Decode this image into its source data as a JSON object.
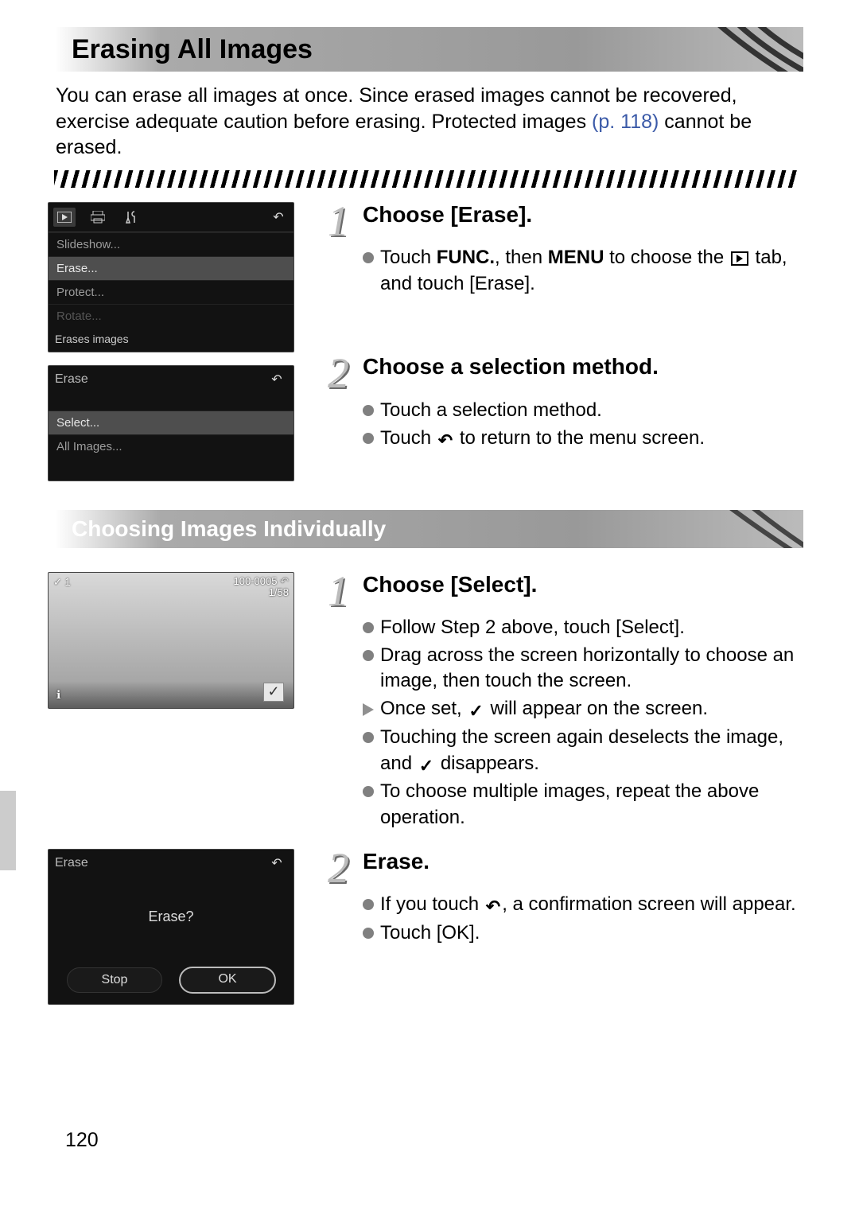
{
  "section1_title": "Erasing All Images",
  "intro_pre": "You can erase all images at once. Since erased images cannot be recovered, exercise adequate caution before erasing. Protected images ",
  "intro_link": "(p. 118)",
  "intro_post": " cannot be erased.",
  "lcd1": {
    "items": [
      "Slideshow...",
      "Erase...",
      "Protect...",
      "Rotate...",
      "Erases images"
    ]
  },
  "lcd2": {
    "title": "Erase",
    "items": [
      "Select...",
      "All Images..."
    ]
  },
  "step1": {
    "num": "1",
    "title": "Choose [Erase].",
    "b1_pre": "Touch ",
    "b1_func": "FUNC.",
    "b1_mid": ", then ",
    "b1_menu": "MENU",
    "b1_post1": " to choose the ",
    "b1_post2": " tab, and touch [Erase]."
  },
  "step2": {
    "num": "2",
    "title": "Choose a selection method.",
    "b1": "Touch a selection method.",
    "b2_pre": "Touch ",
    "b2_post": " to return to the menu screen."
  },
  "section2_title": "Choosing Images Individually",
  "lcd3": {
    "tl": "✓ 1",
    "tr1": "100-0005",
    "tr2": "1/58"
  },
  "step3": {
    "num": "1",
    "title": "Choose [Select].",
    "b1": "Follow Step 2 above, touch [Select].",
    "b2": "Drag across the screen horizontally to choose an image, then touch the screen.",
    "b3_pre": "Once set, ",
    "b3_post": " will appear on the screen.",
    "b4_pre": "Touching the screen again deselects the image, and ",
    "b4_post": " disappears.",
    "b5": "To choose multiple images, repeat the above operation."
  },
  "lcd4": {
    "title": "Erase",
    "q": "Erase?",
    "stop": "Stop",
    "ok": "OK"
  },
  "step4": {
    "num": "2",
    "title": "Erase.",
    "b1_pre": "If you touch ",
    "b1_post": ", a confirmation screen will appear.",
    "b2": "Touch [OK]."
  },
  "page_number": "120"
}
